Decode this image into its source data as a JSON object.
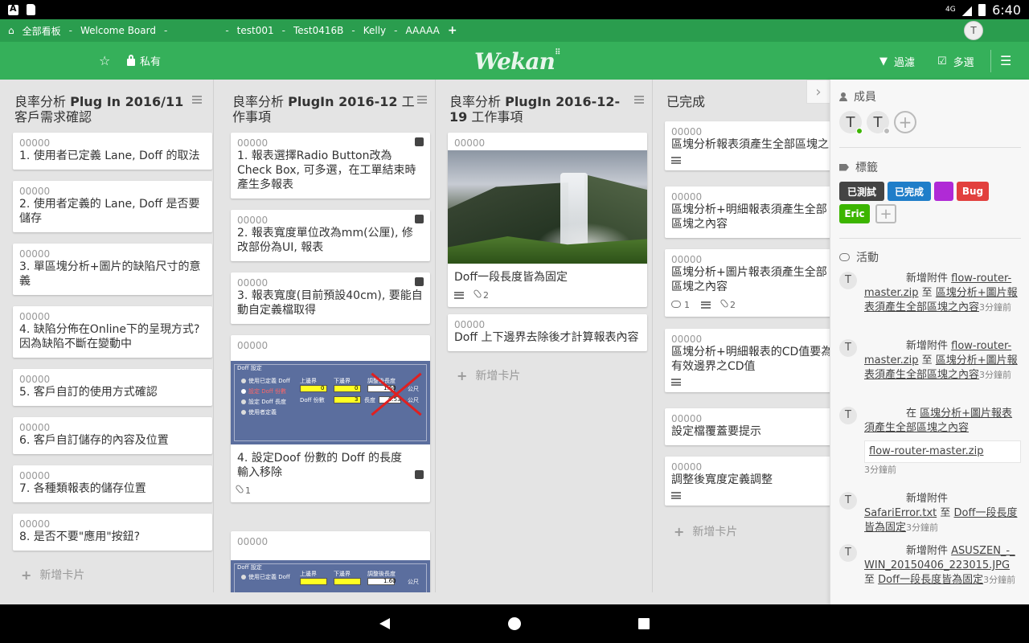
{
  "status": {
    "time": "6:40",
    "network": "4G"
  },
  "boards": {
    "home": "全部看板",
    "items": [
      "Welcome Board",
      "",
      "test001",
      "Test0416B",
      "Kelly",
      "AAAAA"
    ],
    "user_initial": "T"
  },
  "header": {
    "privacy": "私有",
    "logo": "Wekan",
    "filter": "過濾",
    "multiselect": "多選"
  },
  "lists": [
    {
      "title_prefix": "良率分析 ",
      "title_bold": "Plug In 2016/11",
      "title_suffix": " 客戶需求確認",
      "cards": [
        {
          "num": "00000",
          "title": "1. 使用者已定義 Lane, Doff 的取法"
        },
        {
          "num": "00000",
          "title": "2. 使用者定義的 Lane, Doff 是否要儲存"
        },
        {
          "num": "00000",
          "title": "3. 單區塊分析+圖片的缺陷尺寸的意義"
        },
        {
          "num": "00000",
          "title": "4. 缺陷分佈在Online下的呈現方式? 因為缺陷不斷在變動中"
        },
        {
          "num": "00000",
          "title": "5. 客戶自訂的使用方式確認"
        },
        {
          "num": "00000",
          "title": "6. 客戶自訂儲存的內容及位置"
        },
        {
          "num": "00000",
          "title": "7. 各種類報表的儲存位置"
        },
        {
          "num": "00000",
          "title": "8. 是否不要\"應用\"按鈕?"
        }
      ],
      "add": "新增卡片"
    },
    {
      "title_prefix": "良率分析 ",
      "title_bold": "PlugIn 2016-12",
      "title_suffix": " 工作事項",
      "cards": [
        {
          "num": "00000",
          "title": "1. 報表選擇Radio Button改為Check Box, 可多選，在工單結束時產生多報表"
        },
        {
          "num": "00000",
          "title": "2. 報表寬度單位改為mm(公厘), 修改部份為UI, 報表"
        },
        {
          "num": "00000",
          "title": "3. 報表寬度(目前預設40cm), 要能自動自定義檔取得"
        },
        {
          "num": "00000",
          "title": "4. 設定Doof 份數的 Doff 的長度輸入移除",
          "attachments": "1"
        },
        {
          "num": "00000",
          "title": ""
        }
      ],
      "form_image": {
        "heading": "Doff 設定",
        "options": [
          "使用已定義 Doff",
          "設定 Doff 份數",
          "設定 Doff 長度",
          "使用者定義"
        ],
        "upper": "上邊界",
        "lower": "下邊界",
        "adjusted": "調整後長度",
        "count_label": "Doff 份數",
        "length_label": "長度",
        "unit": "公尺",
        "v1": "0",
        "v2": "0",
        "v3": "1.60",
        "v4": "3",
        "v5": "0.53"
      }
    },
    {
      "title_prefix": "良率分析 ",
      "title_bold": "PlugIn 2016-12-19",
      "title_suffix": " 工作事項",
      "cards": [
        {
          "num": "00000",
          "title": "Doff一段長度皆為固定",
          "attachments": "2"
        },
        {
          "num": "00000",
          "title": "Doff 上下邊界去除後才計算報表內容"
        }
      ],
      "add": "新增卡片"
    },
    {
      "title": "已完成",
      "cards": [
        {
          "num": "00000",
          "title": "區塊分析報表須產生全部區塊之"
        },
        {
          "num": "00000",
          "title": "區塊分析+明細報表須產生全部區塊之內容"
        },
        {
          "num": "00000",
          "title": "區塊分析+圖片報表須產生全部區塊之內容",
          "comments": "1",
          "attachments": "2"
        },
        {
          "num": "00000",
          "title": "區塊分析+明細報表的CD值要為有效邊界之CD值"
        },
        {
          "num": "00000",
          "title": "設定檔覆蓋要提示"
        },
        {
          "num": "00000",
          "title": "調整後寬度定義調整"
        }
      ],
      "add": "新增卡片"
    }
  ],
  "sidebar": {
    "members_title": "成員",
    "member_initials": [
      "T",
      "T"
    ],
    "labels_title": "標籤",
    "labels": [
      {
        "text": "已測試",
        "color": "#444444"
      },
      {
        "text": "已完成",
        "color": "#1f7ec9"
      },
      {
        "text": "",
        "color": "#b02ad6"
      },
      {
        "text": "Bug",
        "color": "#e2403e"
      },
      {
        "text": "Eric",
        "color": "#3cb500"
      }
    ],
    "activity_title": "活動",
    "activities": [
      {
        "initial": "T",
        "action": "新增附件",
        "file": "flow-router-master.zip",
        "to": "至",
        "target": "區塊分析+圖片報表須產生全部區塊之內容",
        "time": "3分鐘前"
      },
      {
        "initial": "T",
        "action": "新增附件",
        "file": "flow-router-master.zip",
        "to": "至",
        "target": "區塊分析+圖片報表須產生全部區塊之內容",
        "time": "3分鐘前"
      },
      {
        "initial": "T",
        "action": "在",
        "target": "區塊分析+圖片報表須產生全部區塊之內容",
        "attachment": "flow-router-master.zip",
        "time": "3分鐘前"
      },
      {
        "initial": "T",
        "action": "新增附件",
        "file": "SafariError.txt",
        "to": "至",
        "target": "Doff一段長度皆為固定",
        "time": "3分鐘前"
      },
      {
        "initial": "T",
        "action": "新增附件",
        "file": "ASUSZEN_-_WIN_20150406_223015.JPG",
        "to": "至",
        "target": "Doff一段長度皆為固定",
        "time": "3分鐘前"
      }
    ]
  }
}
